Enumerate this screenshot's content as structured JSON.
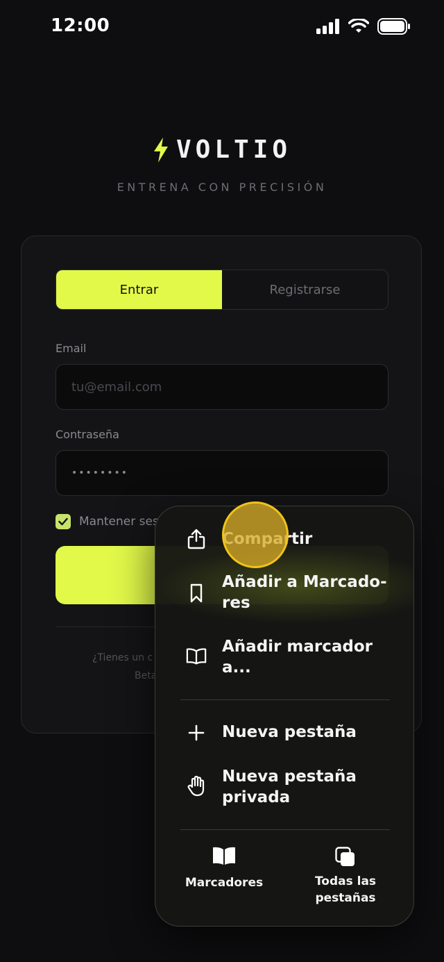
{
  "status_bar": {
    "time": "12:00"
  },
  "brand": {
    "name": "VOLTIO",
    "tagline": "ENTRENA CON PRECISIÓN",
    "accent": "#e2f94a"
  },
  "auth": {
    "tabs": [
      {
        "label": "Entrar",
        "active": true
      },
      {
        "label": "Registrarse",
        "active": false
      }
    ],
    "email_label": "Email",
    "email_placeholder": "tu@email.com",
    "password_label": "Contraseña",
    "password_value": "••••••••",
    "keep_label": "Mantener ses",
    "keep_checked": true,
    "footer_line1": "¿Tienes un c",
    "footer_line2": "Beta"
  },
  "menu": {
    "items": [
      {
        "label": "Compartir",
        "icon": "share-icon"
      },
      {
        "label": "Añadir a Marcado-\nres",
        "icon": "bookmark-icon"
      },
      {
        "label": "Añadir marcador\na...",
        "icon": "book-icon"
      },
      {
        "label": "Nueva pestaña",
        "icon": "plus-icon"
      },
      {
        "label": "Nueva pestaña\nprivada",
        "icon": "hand-icon"
      }
    ],
    "bottom": [
      {
        "label": "Marcadores",
        "icon": "book-filled-icon"
      },
      {
        "label": "Todas las\npestañas",
        "icon": "tabs-icon"
      }
    ]
  }
}
